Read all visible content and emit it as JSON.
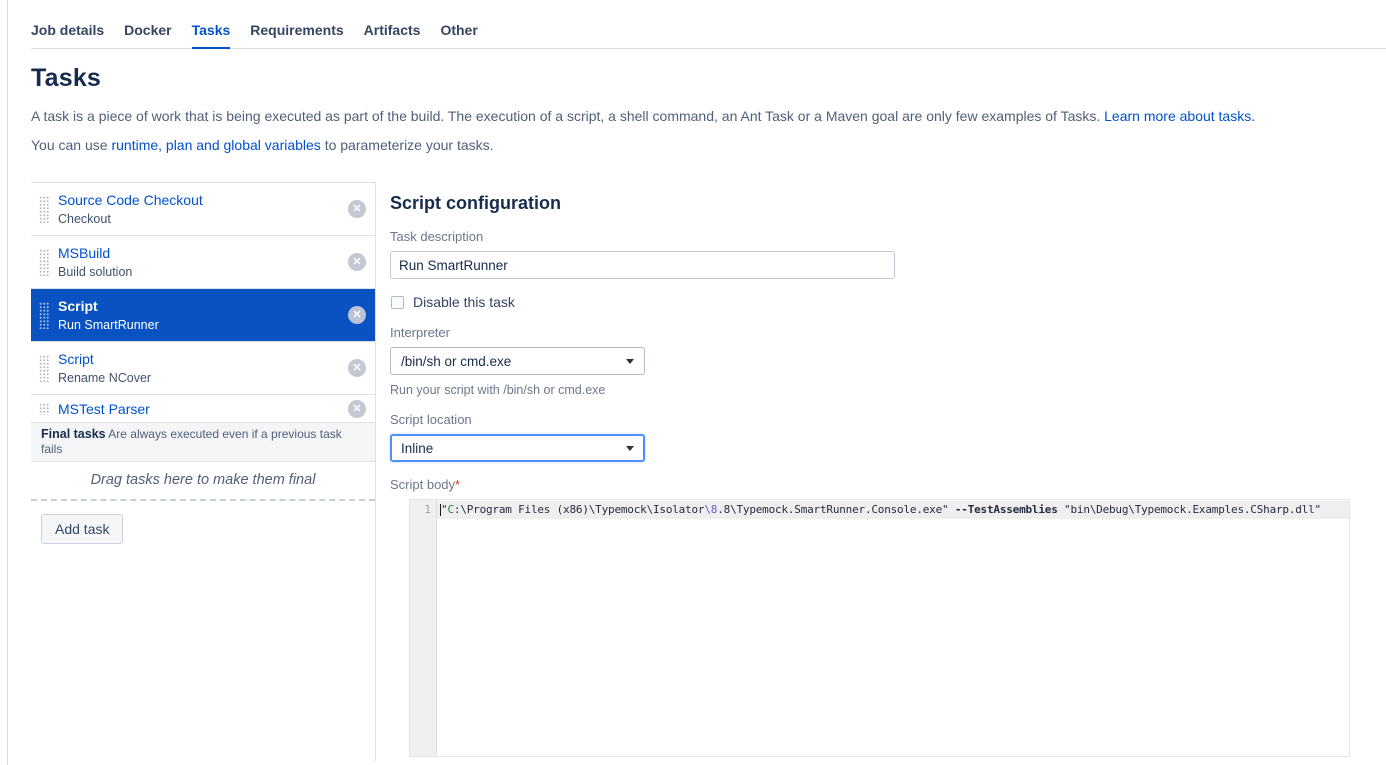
{
  "tabs": {
    "items": [
      {
        "label": "Job details",
        "active": false
      },
      {
        "label": "Docker",
        "active": false
      },
      {
        "label": "Tasks",
        "active": true
      },
      {
        "label": "Requirements",
        "active": false
      },
      {
        "label": "Artifacts",
        "active": false
      },
      {
        "label": "Other",
        "active": false
      }
    ]
  },
  "page": {
    "title": "Tasks",
    "intro_text": "A task is a piece of work that is being executed as part of the build. The execution of a script, a shell command, an Ant Task or a Maven goal are only few examples of Tasks.",
    "intro_link": "Learn more about tasks.",
    "vars_prefix": "You can use",
    "vars_link": "runtime, plan and global variables",
    "vars_suffix": "to parameterize your tasks."
  },
  "task_list": {
    "items": [
      {
        "title": "Source Code Checkout",
        "subtitle": "Checkout"
      },
      {
        "title": "MSBuild",
        "subtitle": "Build solution"
      },
      {
        "title": "Script",
        "subtitle": "Run SmartRunner"
      },
      {
        "title": "Script",
        "subtitle": "Rename NCover"
      },
      {
        "title": "MSTest Parser",
        "subtitle": ""
      }
    ],
    "selected_index": 2,
    "final_tasks_label": "Final tasks",
    "final_tasks_desc": "Are always executed even if a previous task fails",
    "drag_hint": "Drag tasks here to make them final",
    "add_task_label": "Add task"
  },
  "form": {
    "heading": "Script configuration",
    "task_description_label": "Task description",
    "task_description_value": "Run SmartRunner",
    "disable_label": "Disable this task",
    "disable_checked": false,
    "interpreter_label": "Interpreter",
    "interpreter_value": "/bin/sh or cmd.exe",
    "interpreter_help": "Run your script with /bin/sh or cmd.exe",
    "script_location_label": "Script location",
    "script_location_value": "Inline",
    "script_body_label": "Script body",
    "required_marker": "*",
    "editor": {
      "line_number": "1",
      "full_text": "\"C:\\Program Files (x86)\\Typemock\\Isolator\\8.8\\Typemock.SmartRunner.Console.exe\" --TestAssemblies \"bin\\Debug\\Typemock.Examples.CSharp.dll\"",
      "segments": [
        {
          "text": "\"",
          "style": "plain"
        },
        {
          "text": "C",
          "style": "green"
        },
        {
          "text": ":\\Program Files (x86)\\Typemock\\Isolator",
          "style": "plain"
        },
        {
          "text": "\\8",
          "style": "purple"
        },
        {
          "text": ".8\\Typemock.SmartRunner.Console.exe\" ",
          "style": "plain"
        },
        {
          "text": "--TestAssemblies",
          "style": "bold"
        },
        {
          "text": " \"bin\\Debug\\Typemock.Examples.CSharp.dll\"",
          "style": "plain"
        }
      ]
    }
  },
  "colors": {
    "accent": "#0052cc",
    "selected_task_bg": "#0a52c1",
    "required_marker": "#de350b",
    "tab_text": "#344563",
    "heading_text": "#172b4d"
  }
}
